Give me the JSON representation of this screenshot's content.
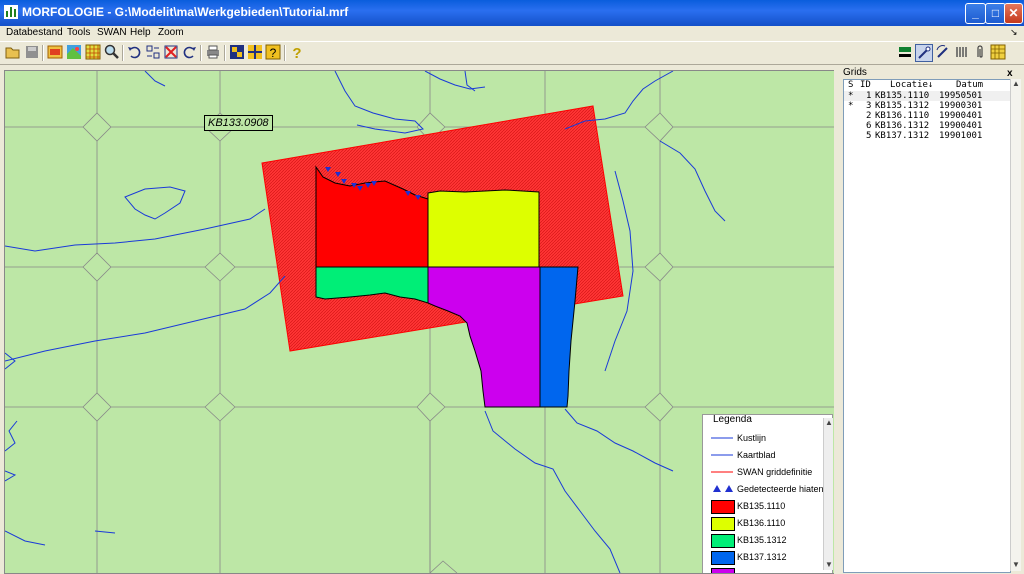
{
  "app": {
    "title": "MORFOLOGIE - G:\\Modelit\\ma\\Werkgebieden\\Tutorial.mrf",
    "controls": {
      "minimize": "_",
      "maximize": "□",
      "close": "✕"
    }
  },
  "menu": [
    "Databestand",
    "Tools",
    "SWAN",
    "Help",
    "Zoom"
  ],
  "toolbar": {
    "icons": [
      "open-folder-icon",
      "save-icon",
      "grid-edit-icon",
      "color-map-icon",
      "grid-icon",
      "zoom-icon",
      "undo-icon",
      "grid-swap-icon",
      "delete-grid-icon",
      "redo-icon",
      "print-icon",
      "grid-overlay-icon",
      "grid-split-icon",
      "help-grid-icon",
      "question-icon"
    ],
    "right_icons": [
      "layer-icon",
      "wand-icon",
      "rotate-icon",
      "table-icon",
      "paperclip-icon",
      "grid-view-icon"
    ]
  },
  "map": {
    "label": "KB133.0908",
    "colors": {
      "land": "#bde7a6",
      "coast": "#1a3ad8",
      "swan": "#ff3030"
    }
  },
  "legend": {
    "title": "Legenda",
    "items": [
      {
        "label": "Kustlijn",
        "kind": "line",
        "color": "#1a3ad8"
      },
      {
        "label": "Kaartblad",
        "kind": "line",
        "color": "#1a3ad8"
      },
      {
        "label": "SWAN griddefinitie",
        "kind": "line",
        "color": "#ff0000"
      },
      {
        "label": "Gedetecteerde hiaten",
        "kind": "triangles",
        "color": "#2030d0"
      },
      {
        "label": "KB135.1110",
        "kind": "box",
        "color": "#ff0000"
      },
      {
        "label": "KB136.1110",
        "kind": "box",
        "color": "#ddff00"
      },
      {
        "label": "KB135.1312",
        "kind": "box",
        "color": "#00ee77"
      },
      {
        "label": "KB137.1312",
        "kind": "box",
        "color": "#0066ee"
      },
      {
        "label": "",
        "kind": "box",
        "color": "#cc00ee"
      }
    ]
  },
  "grids": {
    "title": "Grids",
    "close": "x",
    "headers": {
      "s": "S",
      "id": "ID",
      "locatie": "Locatie↓",
      "datum": "Datum"
    },
    "rows": [
      {
        "s": "*",
        "id": "1",
        "locatie": "KB135.1110",
        "datum": "19950501",
        "selected": true
      },
      {
        "s": "*",
        "id": "3",
        "locatie": "KB135.1312",
        "datum": "19900301",
        "selected": false
      },
      {
        "s": "",
        "id": "2",
        "locatie": "KB136.1110",
        "datum": "19900401",
        "selected": false
      },
      {
        "s": "",
        "id": "6",
        "locatie": "KB136.1312",
        "datum": "19900401",
        "selected": false
      },
      {
        "s": "",
        "id": "5",
        "locatie": "KB137.1312",
        "datum": "19901001",
        "selected": false
      }
    ]
  }
}
